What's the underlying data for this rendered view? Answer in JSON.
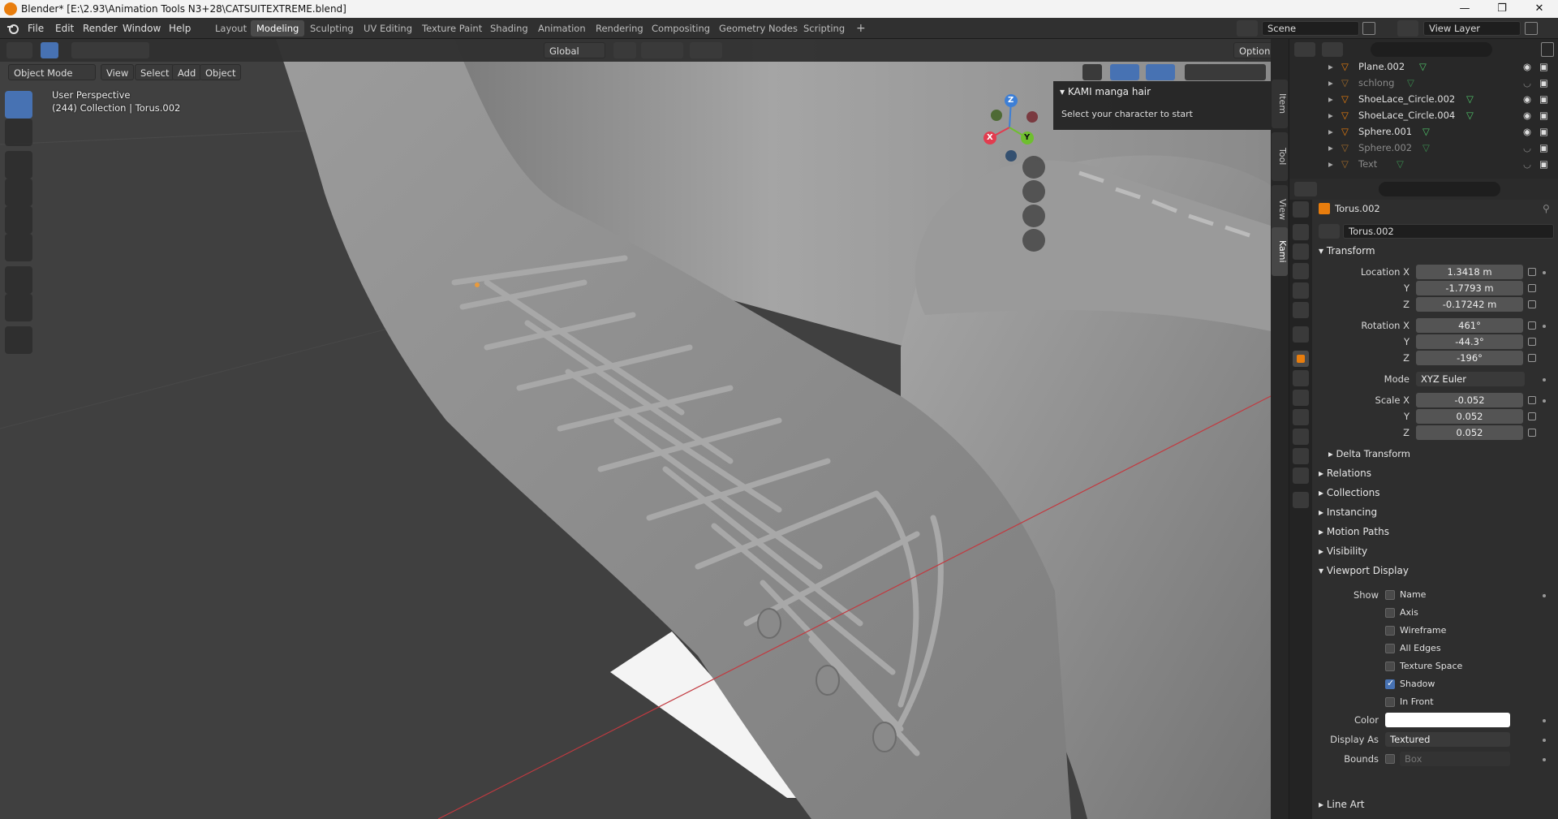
{
  "window": {
    "title": "Blender* [E:\\2.93\\Animation Tools N3+28\\CATSUITEXTREME.blend]",
    "min_glyph": "—",
    "max_glyph": "❐",
    "close_glyph": "✕"
  },
  "menu": [
    "File",
    "Edit",
    "Render",
    "Window",
    "Help"
  ],
  "workspaces": [
    "Layout",
    "Modeling",
    "Sculpting",
    "UV Editing",
    "Texture Paint",
    "Shading",
    "Animation",
    "Rendering",
    "Compositing",
    "Geometry Nodes",
    "Scripting"
  ],
  "active_workspace": "Modeling",
  "scene": {
    "name": "Scene",
    "view_layer": "View Layer",
    "add_glyph": "+"
  },
  "viewport_header": {
    "mode": "Object Mode",
    "menus": [
      "View",
      "Select",
      "Add",
      "Object"
    ],
    "transform_orientation": "Global",
    "options": "Options"
  },
  "viewport_overlay": {
    "perspective": "User Perspective",
    "collection": "(244) Collection | Torus.002"
  },
  "gizmo": {
    "x": "X",
    "y": "Y",
    "z": "Z"
  },
  "npanel": {
    "title": "KAMI manga hair",
    "body": "Select your character to start",
    "tabs": [
      "Item",
      "Tool",
      "View",
      "Kami"
    ],
    "active_tab": "Kami"
  },
  "outliner": {
    "rows": [
      {
        "name": "Plane.002",
        "dim": false
      },
      {
        "name": "schlong",
        "dim": true
      },
      {
        "name": "ShoeLace_Circle.002",
        "dim": false
      },
      {
        "name": "ShoeLace_Circle.004",
        "dim": false
      },
      {
        "name": "Sphere.001",
        "dim": false
      },
      {
        "name": "Sphere.002",
        "dim": true
      },
      {
        "name": "Text",
        "dim": true
      }
    ]
  },
  "properties": {
    "object_name": "Torus.002",
    "datablock": "Torus.002",
    "transform": {
      "title": "Transform",
      "location_label": "Location X",
      "location": [
        "1.3418 m",
        "-1.7793 m",
        "-0.17242 m"
      ],
      "rotation_label": "Rotation X",
      "rotation": [
        "461°",
        "-44.3°",
        "-196°"
      ],
      "mode_label": "Mode",
      "mode": "XYZ Euler",
      "scale_label": "Scale X",
      "scale": [
        "-0.052",
        "0.052",
        "0.052"
      ],
      "y": "Y",
      "z": "Z"
    },
    "delta_transform": "Delta Transform",
    "sections": [
      "Relations",
      "Collections",
      "Instancing",
      "Motion Paths",
      "Visibility"
    ],
    "viewport_display": {
      "title": "Viewport Display",
      "show_label": "Show",
      "options": [
        {
          "label": "Name",
          "checked": false
        },
        {
          "label": "Axis",
          "checked": false
        },
        {
          "label": "Wireframe",
          "checked": false
        },
        {
          "label": "All Edges",
          "checked": false
        },
        {
          "label": "Texture Space",
          "checked": false
        },
        {
          "label": "Shadow",
          "checked": true
        },
        {
          "label": "In Front",
          "checked": false
        }
      ],
      "color_label": "Color",
      "display_as_label": "Display As",
      "display_as": "Textured",
      "bounds_label": "Bounds",
      "bounds": "Box"
    },
    "line_art": "Line Art"
  },
  "colors": {
    "accent": "#4772b3",
    "orange": "#e87d0d",
    "axis_x": "#e23c4f",
    "axis_y": "#6fbf2f",
    "axis_z": "#3d7fd6",
    "mesh_icon": "#4fc46a"
  }
}
